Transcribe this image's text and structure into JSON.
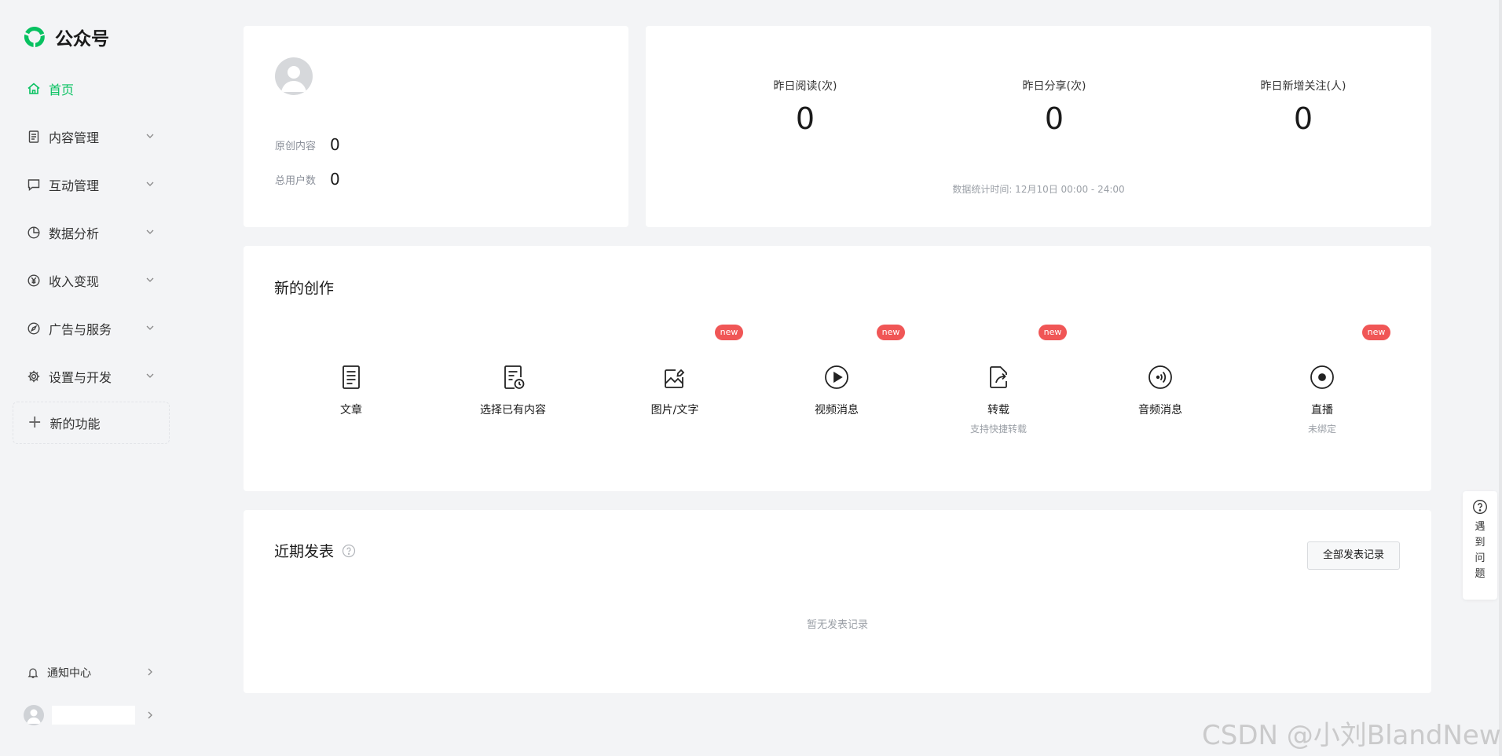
{
  "app": {
    "title": "公众号",
    "brand_color": "#07c160"
  },
  "sidebar": {
    "home": {
      "label": "首页",
      "icon": "home-icon"
    },
    "items": [
      {
        "label": "内容管理",
        "icon": "document-icon"
      },
      {
        "label": "互动管理",
        "icon": "chat-icon"
      },
      {
        "label": "数据分析",
        "icon": "pie-chart-icon"
      },
      {
        "label": "收入变现",
        "icon": "yen-icon"
      },
      {
        "label": "广告与服务",
        "icon": "compass-icon"
      },
      {
        "label": "设置与开发",
        "icon": "gear-icon"
      }
    ],
    "new_feature": "新的功能",
    "notify": "通知中心"
  },
  "account": {
    "original_label": "原创内容",
    "original_value": "0",
    "users_label": "总用户数",
    "users_value": "0"
  },
  "stats": {
    "reads_label": "昨日阅读(次)",
    "reads_value": "0",
    "shares_label": "昨日分享(次)",
    "shares_value": "0",
    "follows_label": "昨日新增关注(人)",
    "follows_value": "0",
    "footnote": "数据统计时间: 12月10日 00:00 - 24:00"
  },
  "create": {
    "title": "新的创作",
    "badge": "new",
    "items": [
      {
        "label": "文章",
        "sub": "",
        "new": false
      },
      {
        "label": "选择已有内容",
        "sub": "",
        "new": false
      },
      {
        "label": "图片/文字",
        "sub": "",
        "new": true
      },
      {
        "label": "视频消息",
        "sub": "",
        "new": true
      },
      {
        "label": "转载",
        "sub": "支持快捷转载",
        "new": true
      },
      {
        "label": "音频消息",
        "sub": "",
        "new": false
      },
      {
        "label": "直播",
        "sub": "未绑定",
        "new": true
      }
    ]
  },
  "recent": {
    "title": "近期发表",
    "all_button": "全部发表记录",
    "empty": "暂无发表记录"
  },
  "help_float": {
    "text": "遇到问题"
  },
  "watermark": "CSDN @小刘BlandNew"
}
